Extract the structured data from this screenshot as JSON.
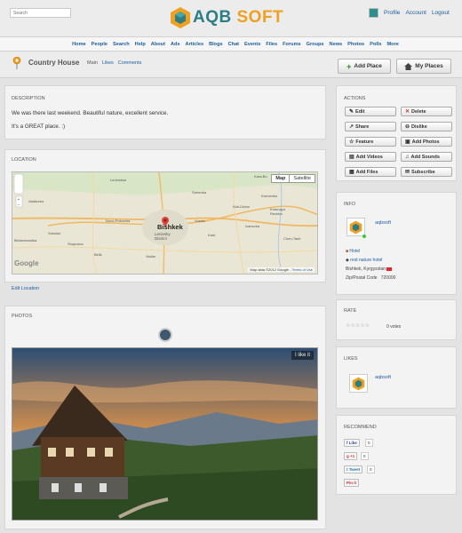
{
  "search": {
    "placeholder": "Search"
  },
  "brand": {
    "part1": "AQB ",
    "part2": "SOFT"
  },
  "user_nav": [
    "Profile",
    "Account",
    "Logout"
  ],
  "menu": [
    "Home",
    "People",
    "Search",
    "Help",
    "About",
    "Ads",
    "Articles",
    "Blogs",
    "Chat",
    "Events",
    "Files",
    "Forums",
    "Groups",
    "News",
    "Photos",
    "Polls",
    "More"
  ],
  "page": {
    "title": "Country House",
    "tabs": [
      "Main",
      "Likes",
      "Comments"
    ]
  },
  "buttons": {
    "add_place": "Add Place",
    "my_places": "My Places"
  },
  "description": {
    "title": "DESCRIPTION",
    "line1": "We was there last weekend. Beautiful nature, excellent service.",
    "line2": "It's a GREAT place. :)"
  },
  "location": {
    "title": "LOCATION",
    "map_type_map": "Map",
    "map_type_sat": "Satellite",
    "city": "Bishkek",
    "district": "Leninsky District",
    "attribution": "Map data ©2012 Google",
    "terms": "Terms of Use",
    "google": "Google",
    "edit_link": "Edit Location",
    "places": [
      "Leninskoe",
      "Kara-Bu",
      "Sretenka",
      "Vasilevka",
      "Kremenko",
      "Novo-Pokrovka",
      "Vostok",
      "Beloedomolka",
      "Sokuluk",
      "Shopokov",
      "Kok-Dzhar",
      "Krasnaya Rechka",
      "Ivanovka",
      "Kant",
      "Chon-Tash",
      "Birlik",
      "Vadim"
    ]
  },
  "photos": {
    "title": "PHOTOS",
    "like_label": "I like it"
  },
  "actions": {
    "title": "ACTIONS",
    "items": [
      {
        "label": "Edit",
        "icon": "edit-icon"
      },
      {
        "label": "Delete",
        "icon": "delete-icon"
      },
      {
        "label": "Share",
        "icon": "share-icon"
      },
      {
        "label": "Dislike",
        "icon": "dislike-icon"
      },
      {
        "label": "Feature",
        "icon": "feature-icon"
      },
      {
        "label": "Add Photos",
        "icon": "add-photos-icon"
      },
      {
        "label": "Add Videos",
        "icon": "add-videos-icon"
      },
      {
        "label": "Add Sounds",
        "icon": "add-sounds-icon"
      },
      {
        "label": "Add Files",
        "icon": "add-files-icon"
      },
      {
        "label": "Subscribe",
        "icon": "subscribe-icon"
      }
    ]
  },
  "info": {
    "title": "INFO",
    "user": "aqbsoft",
    "category": "Hotel",
    "tags": "rest nature hotel",
    "city": "Bishkek, Kyrgyzstan",
    "zip_label": "Zip/Postal Code",
    "zip": "720000"
  },
  "rate": {
    "title": "RATE",
    "votes": "0 votes",
    "stars": 5,
    "value": 0
  },
  "likes": {
    "title": "LIKES",
    "user": "aqbsoft"
  },
  "recommend": {
    "title": "RECOMMEND",
    "items": [
      {
        "label": "Like",
        "count": "0"
      },
      {
        "label": "+1",
        "count": "0"
      },
      {
        "label": "Tweet",
        "count": "0"
      },
      {
        "label": "Pin it",
        "count": ""
      }
    ]
  },
  "colors": {
    "brand_teal": "#2d7d84",
    "brand_orange": "#f0a020",
    "link": "#2060a0",
    "delete_red": "#c0392b"
  }
}
